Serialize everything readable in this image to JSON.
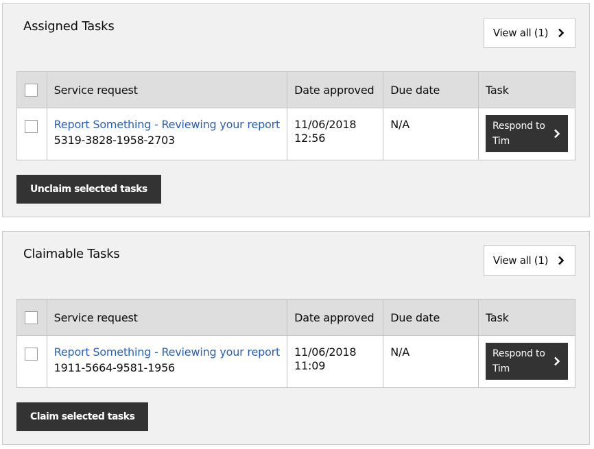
{
  "sections": [
    {
      "title": "Assigned Tasks",
      "view_all_label": "View all (1)",
      "columns": [
        "Service request",
        "Date approved",
        "Due date",
        "Task"
      ],
      "rows": [
        {
          "service_link": "Report Something - Reviewing your report",
          "reference": "5319-3828-1958-2703",
          "date_approved_date": "11/06/2018",
          "date_approved_time": "12:56",
          "due_date": "N/A",
          "task_button": "Respond to Tim"
        }
      ],
      "action_button": "Unclaim selected tasks"
    },
    {
      "title": "Claimable Tasks",
      "view_all_label": "View all (1)",
      "columns": [
        "Service request",
        "Date approved",
        "Due date",
        "Task"
      ],
      "rows": [
        {
          "service_link": "Report Something - Reviewing your report",
          "reference": "1911-5664-9581-1956",
          "date_approved_date": "11/06/2018",
          "date_approved_time": "11:09",
          "due_date": "N/A",
          "task_button": "Respond to Tim"
        }
      ],
      "action_button": "Claim selected tasks"
    }
  ],
  "icons": {
    "view_all": "chevron-right-icon",
    "task_button": "chevron-right-icon"
  },
  "colors": {
    "panel_bg": "#f1f1f1",
    "header_bg": "#dedede",
    "link": "#2b5fb0",
    "button_bg": "#333333"
  }
}
